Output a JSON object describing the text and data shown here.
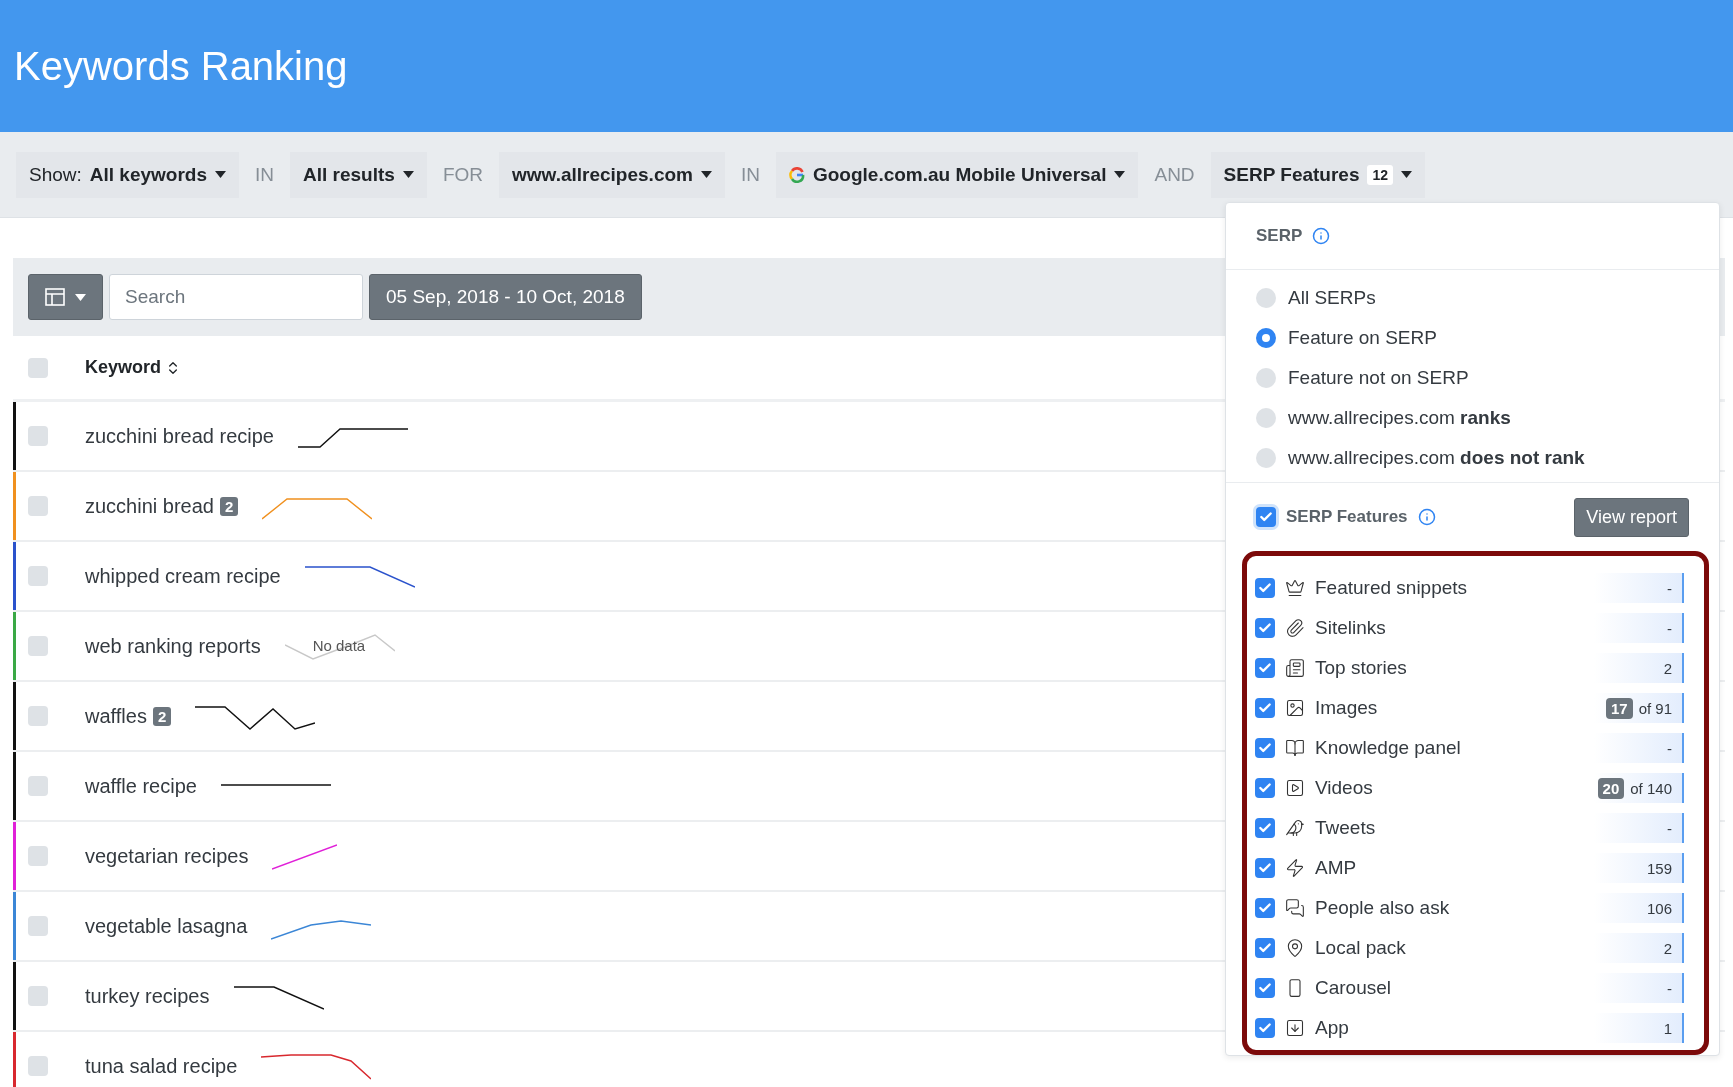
{
  "header": {
    "title": "Keywords Ranking"
  },
  "filters": [
    {
      "kind": "dropdown",
      "prefix": "Show:",
      "value": "All keywords"
    },
    {
      "kind": "joiner",
      "text": "IN"
    },
    {
      "kind": "dropdown",
      "value": "All results"
    },
    {
      "kind": "joiner",
      "text": "FOR"
    },
    {
      "kind": "dropdown",
      "value": "www.allrecipes.com"
    },
    {
      "kind": "joiner",
      "text": "IN"
    },
    {
      "kind": "engine",
      "value": "Google.com.au Mobile Universal"
    },
    {
      "kind": "joiner",
      "text": "AND"
    },
    {
      "kind": "dropdown",
      "value": "SERP Features",
      "badge": "12"
    }
  ],
  "toolbar": {
    "search": {
      "placeholder": "Search"
    },
    "date_range": "05 Sep, 2018 - 10 Oct, 2018"
  },
  "table": {
    "header": {
      "checked": false,
      "column": "Keyword"
    },
    "rows": [
      {
        "keyword": "zucchini bread recipe",
        "checked": false,
        "color": "#111111"
      },
      {
        "keyword": "zucchini bread",
        "badge": "2",
        "checked": false,
        "color": "#f0901e"
      },
      {
        "keyword": "whipped cream recipe",
        "checked": false,
        "color": "#2a52cc"
      },
      {
        "keyword": "web ranking reports",
        "checked": false,
        "color": "#3aa845",
        "note": "No data"
      },
      {
        "keyword": "waffles",
        "badge": "2",
        "checked": false,
        "color": "#111111"
      },
      {
        "keyword": "waffle recipe",
        "checked": false,
        "color": "#111111"
      },
      {
        "keyword": "vegetarian recipes",
        "checked": false,
        "color": "#e020d8"
      },
      {
        "keyword": "vegetable lasagna",
        "checked": false,
        "color": "#3b86d6"
      },
      {
        "keyword": "turkey recipes",
        "checked": false,
        "color": "#111111"
      },
      {
        "keyword": "tuna salad recipe",
        "checked": false,
        "color": "#d8282e"
      }
    ]
  },
  "serp_panel": {
    "title": "SERP",
    "options": [
      {
        "label": "All SERPs",
        "selected": false
      },
      {
        "label": "Feature on SERP",
        "selected": true
      },
      {
        "label": "Feature not on SERP",
        "selected": false
      },
      {
        "label": "www.allrecipes.com **ranks**",
        "selected": false
      },
      {
        "label": "www.allrecipes.com **does not rank**",
        "selected": false
      }
    ],
    "features_toggle": {
      "label": "SERP Features",
      "checked": true
    },
    "view_report": "View report",
    "features": [
      {
        "kind": "crown",
        "label": "Featured snippets",
        "checked": true,
        "count": "-"
      },
      {
        "kind": "paperclip",
        "label": "Sitelinks",
        "checked": true,
        "count": "-"
      },
      {
        "kind": "newspaper",
        "label": "Top stories",
        "checked": true,
        "count": "2"
      },
      {
        "kind": "image",
        "label": "Images",
        "checked": true,
        "badge": "17",
        "count": "of 91"
      },
      {
        "kind": "book",
        "label": "Knowledge panel",
        "checked": true,
        "count": "-"
      },
      {
        "kind": "video",
        "label": "Videos",
        "checked": true,
        "badge": "20",
        "count": "of 140"
      },
      {
        "kind": "bird",
        "label": "Tweets",
        "checked": true,
        "count": "-"
      },
      {
        "kind": "bolt",
        "label": "AMP",
        "checked": true,
        "count": "159"
      },
      {
        "kind": "chat",
        "label": "People also ask",
        "checked": true,
        "count": "106"
      },
      {
        "kind": "pin",
        "label": "Local pack",
        "checked": true,
        "count": "2"
      },
      {
        "kind": "carousel",
        "label": "Carousel",
        "checked": true,
        "count": "-"
      },
      {
        "kind": "app",
        "label": "App",
        "checked": true,
        "count": "1"
      }
    ]
  }
}
